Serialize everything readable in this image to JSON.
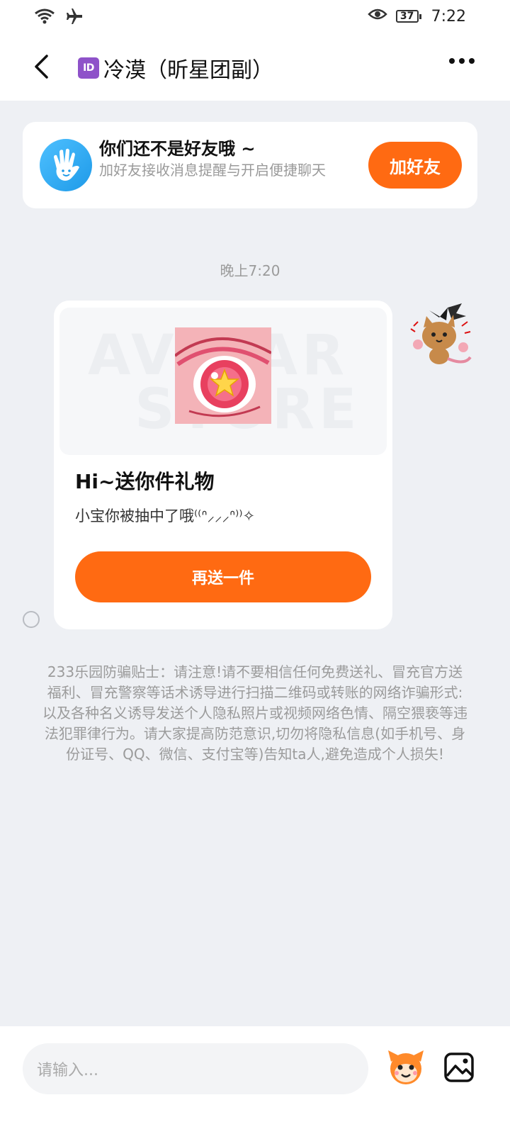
{
  "status_bar": {
    "icons": [
      "wifi-icon",
      "airplane-icon",
      "eye-icon",
      "battery-icon"
    ],
    "battery": "37",
    "time": "7:22"
  },
  "header": {
    "back_icon": "chevron-left-icon",
    "id_badge": "ID",
    "title": "冷漠（昕星团副）",
    "more_icon": "more-dots-icon"
  },
  "friend_banner": {
    "icon": "hand-wave-icon",
    "title": "你们还不是好友哦 ~",
    "subtitle": "加好友接收消息提醒与开启便捷聊天",
    "button": "加好友"
  },
  "timestamp": "晚上7:20",
  "message": {
    "media_watermark": "AVATAR STORE",
    "title": "Hi~送你件礼物",
    "description": "小宝你被抽中了哦⁽⁽ᐢ⸝⸝⸝ᐢ⁾⁾✧",
    "button": "再送一件"
  },
  "notice": "233乐园防骗贴士：请注意!请不要相信任何免费送礼、冒充官方送福利、冒充警察等话术诱导进行扫描二维码或转账的网络诈骗形式:以及各种名义诱导发送个人隐私照片或视频网络色情、隔空猥亵等违法犯罪律行为。请大家提高防范意识,切勿将隐私信息(如手机号、身份证号、QQ、微信、支付宝等)告知ta人,避免造成个人损失!",
  "composer": {
    "placeholder": "请输入...",
    "emoji_icon": "mascot-emoji-icon",
    "image_icon": "image-icon"
  },
  "colors": {
    "accent": "#ff6a12",
    "background": "#eef0f4",
    "hint_text": "#9b9b9b"
  }
}
